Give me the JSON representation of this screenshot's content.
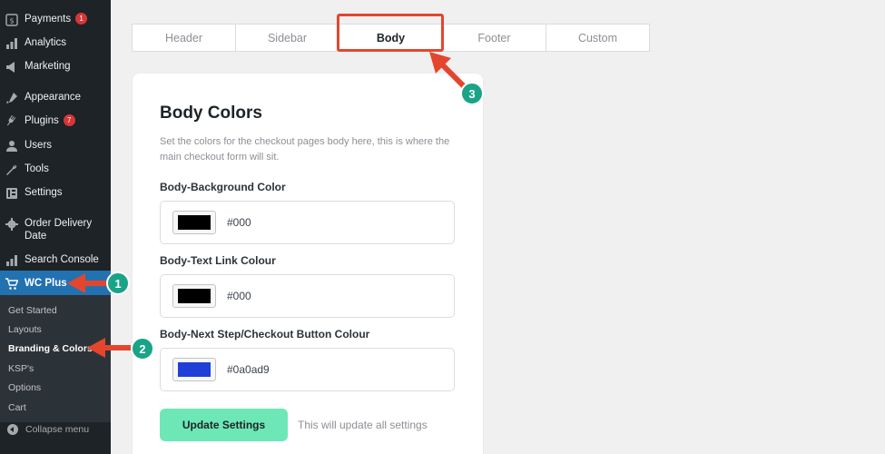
{
  "sidebar": {
    "items": [
      {
        "label": "Payments",
        "icon": "payments-icon",
        "badge": "1"
      },
      {
        "label": "Analytics",
        "icon": "analytics-icon"
      },
      {
        "label": "Marketing",
        "icon": "marketing-icon"
      },
      {
        "label": "Appearance",
        "icon": "appearance-icon"
      },
      {
        "label": "Plugins",
        "icon": "plugins-icon",
        "badge": "7"
      },
      {
        "label": "Users",
        "icon": "users-icon"
      },
      {
        "label": "Tools",
        "icon": "tools-icon"
      },
      {
        "label": "Settings",
        "icon": "settings-icon"
      },
      {
        "label": "Order Delivery Date",
        "icon": "gear-icon"
      },
      {
        "label": "Search Console",
        "icon": "analytics-icon"
      },
      {
        "label": "WC Plus",
        "icon": "cart-icon"
      }
    ],
    "submenu": [
      "Get Started",
      "Layouts",
      "Branding & Colors",
      "KSP's",
      "Options",
      "Cart"
    ],
    "collapse_label": "Collapse menu"
  },
  "tabs": [
    "Header",
    "Sidebar",
    "Body",
    "Footer",
    "Custom"
  ],
  "active_tab": "Body",
  "card": {
    "title": "Body Colors",
    "description": "Set the colors for the checkout pages body here, this is where the main checkout form will sit.",
    "fields": [
      {
        "label": "Body-Background Color",
        "value": "#000",
        "color": "#000000"
      },
      {
        "label": "Body-Text Link Colour",
        "value": "#000",
        "color": "#000000"
      },
      {
        "label": "Body-Next Step/Checkout Button Colour",
        "value": "#0a0ad9",
        "color": "#1f3fd6"
      }
    ],
    "button_label": "Update Settings",
    "button_hint": "This will update all settings"
  },
  "callouts": [
    "1",
    "2",
    "3"
  ],
  "colors": {
    "accent": "#2271b1",
    "callout": "#19a387",
    "arrow": "#e4462d",
    "button": "#6ee7b7"
  }
}
